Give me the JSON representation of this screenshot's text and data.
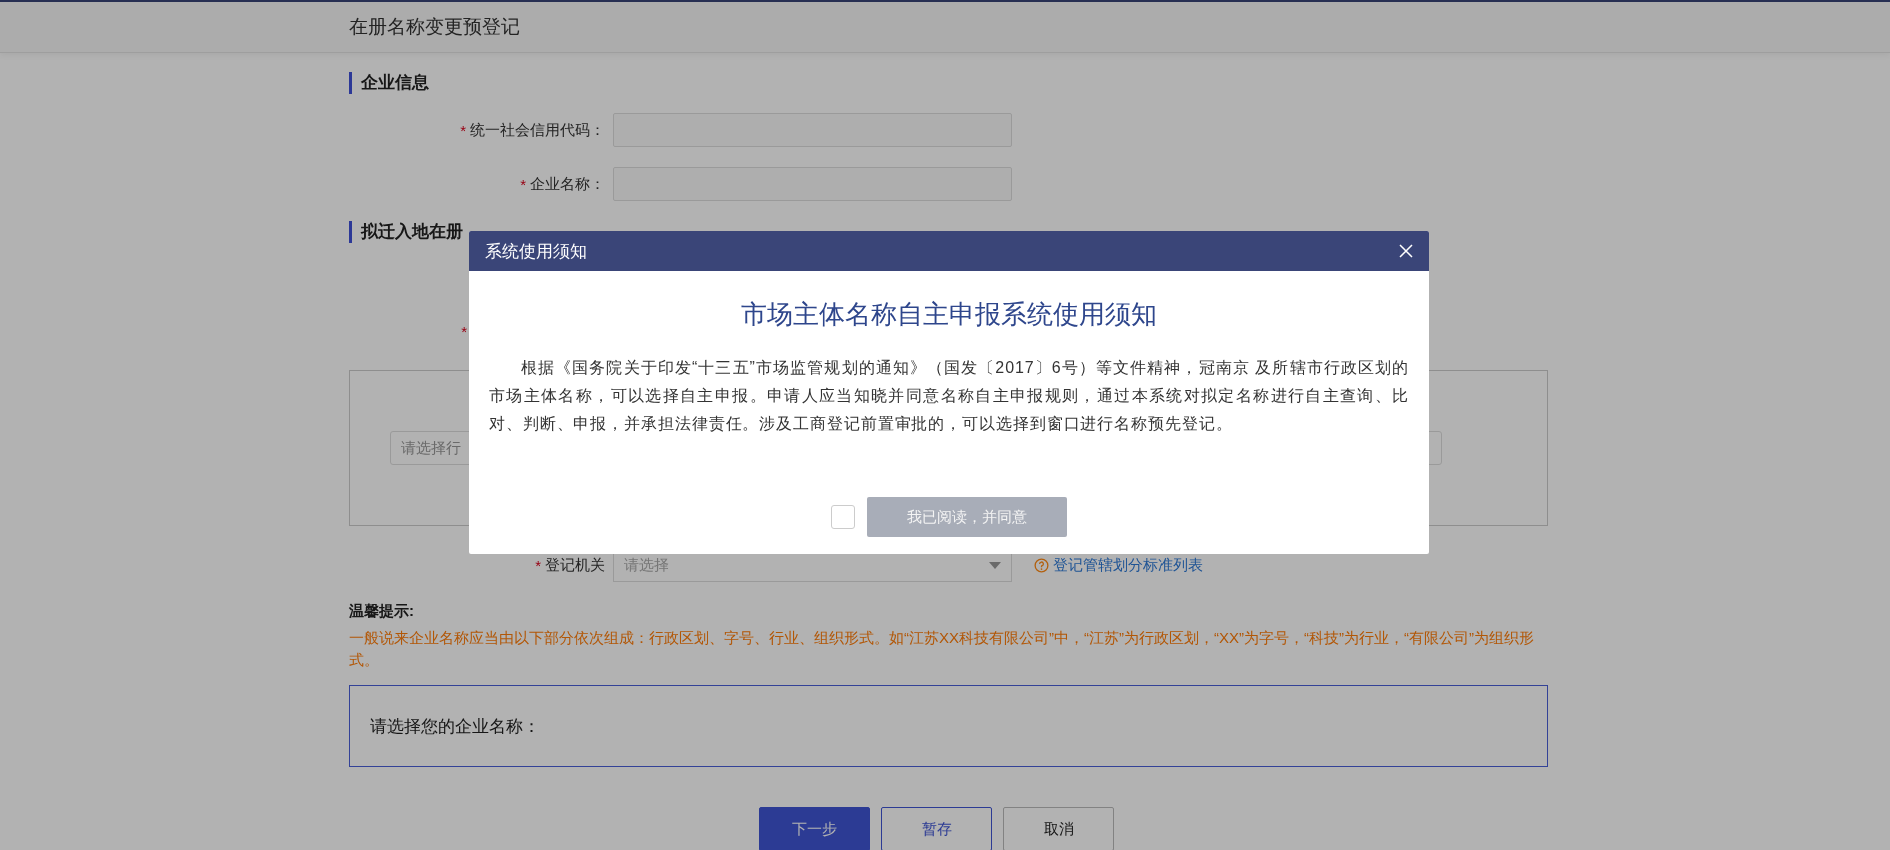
{
  "header": {
    "title": "在册名称变更预登记"
  },
  "section_company": {
    "title": "企业信息",
    "required_mark": "*",
    "fields": [
      {
        "label": "统一社会信用代码：",
        "required": true
      },
      {
        "label": "企业名称：",
        "required": true
      }
    ]
  },
  "section_move": {
    "title": "拟迁入地在册",
    "required_mark": "*",
    "hidden_row": {
      "required": true
    },
    "region_select": {
      "placeholder": "请选择行"
    },
    "authority": {
      "label": "登记机关",
      "required": true,
      "placeholder": "请选择"
    },
    "link": "登记管辖划分标准列表"
  },
  "tips": {
    "title": "温馨提示:",
    "text": "一般说来企业名称应当由以下部分依次组成：行政区划、字号、行业、组织形式。如“江苏XX科技有限公司”中，“江苏”为行政区划，“XX”为字号，“科技”为行业，“有限公司”为组织形式。"
  },
  "name_box": {
    "label": "请选择您的企业名称："
  },
  "buttons": [
    {
      "label": "下一步",
      "kind": "primary"
    },
    {
      "label": "暂存",
      "kind": "outline"
    },
    {
      "label": "取消",
      "kind": "default"
    }
  ],
  "modal": {
    "title": "系统使用须知",
    "heading": "市场主体名称自主申报系统使用须知",
    "body": "根据《国务院关于印发“十三五”市场监管规划的通知》（国发〔2017〕6号）等文件精神，冠南京 及所辖市行政区划的市场主体名称，可以选择自主申报。申请人应当知晓并同意名称自主申报规则，通过本系统对拟定名称进行自主查询、比对、判断、申报，并承担法律责任。涉及工商登记前置审批的，可以选择到窗口进行名称预先登记。",
    "agree_checked": false,
    "agree_button": {
      "label": "我已阅读，并同意",
      "disabled": true
    }
  }
}
